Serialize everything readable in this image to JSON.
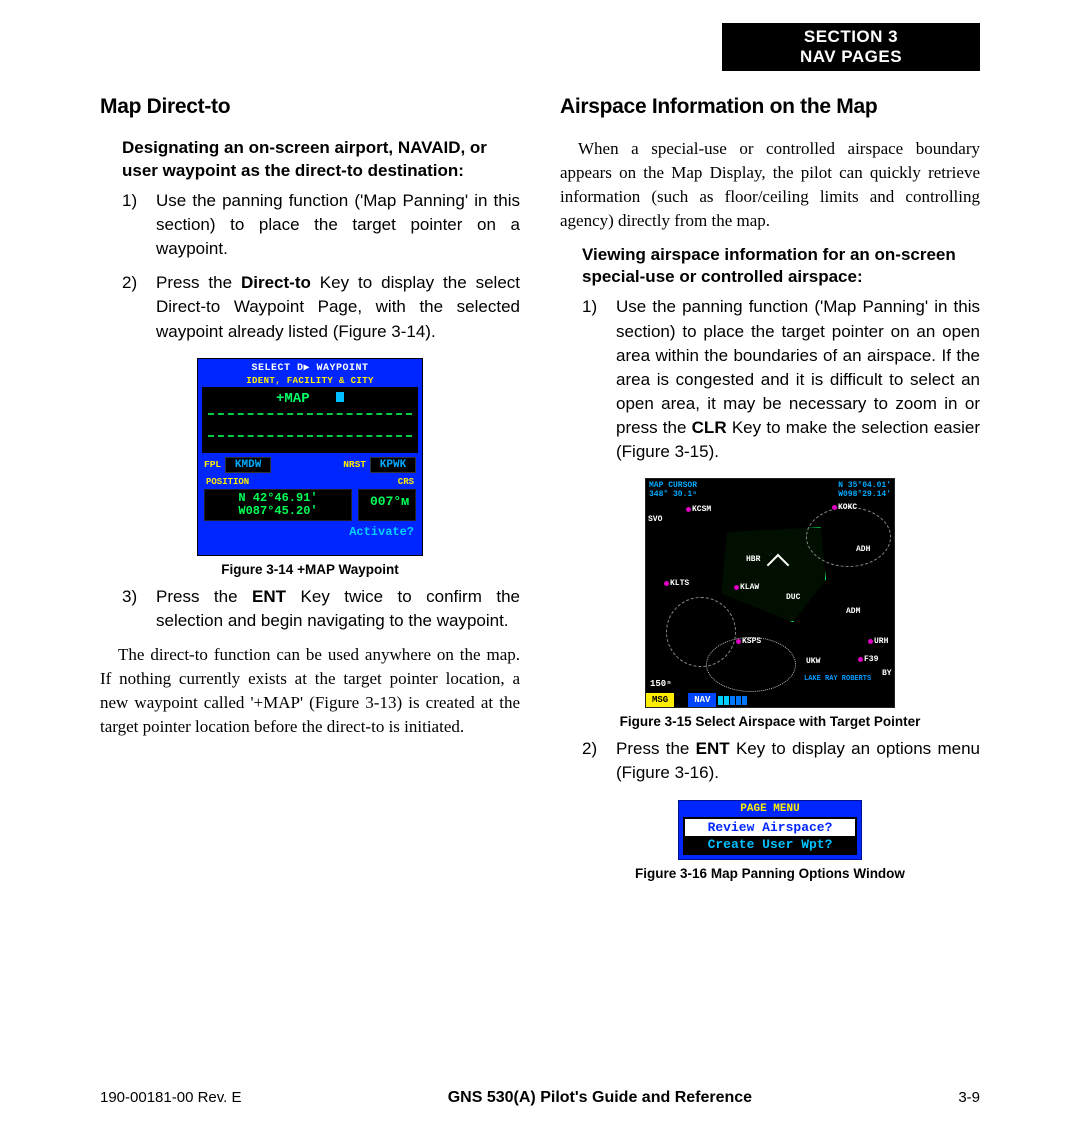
{
  "header": {
    "line1": "SECTION 3",
    "line2": "NAV PAGES"
  },
  "left": {
    "title": "Map Direct-to",
    "subhead": "Designating an on-screen airport, NAVAID, or user waypoint as the direct-to destination:",
    "step1": "Use the panning function ('Map Panning' in this section) to place the target pointer on a waypoint.",
    "step2_a": "Press the ",
    "step2_b": "Direct-to",
    "step2_c": " Key to display the select Direct-to Waypoint Page, with the selected waypoint already listed (Figure 3-14).",
    "step3_a": "Press the ",
    "step3_b": "ENT",
    "step3_c": " Key twice to confirm the selection and begin navigating to the waypoint.",
    "para": "The direct-to function can be used anywhere on the map.  If nothing currently exists at the target pointer location, a new waypoint called '+MAP' (Figure 3-13) is created at the target pointer location before the direct-to is initiated.",
    "fig314": {
      "title_a": "SELECT ",
      "title_b": "D▶",
      "title_c": " WAYPOINT",
      "sub": "IDENT, FACILITY & CITY",
      "map": "+MAP",
      "fpl_label": "FPL",
      "fpl_val": "KMDW",
      "nrst_label": "NRST",
      "nrst_val": "KPWK",
      "pos_label": "POSITION",
      "crs_label": "CRS",
      "pos_n": "N 42°46.91'",
      "pos_w": "W087°45.20'",
      "crs_val": "007°ᴍ",
      "activate": "Activate?",
      "caption": "Figure 3-14  +MAP Waypoint"
    }
  },
  "right": {
    "title": "Airspace Information on the Map",
    "intro": "When a special-use or controlled airspace boundary appears on the Map Display, the pilot can quickly retrieve information (such as floor/ceiling limits and controlling agency) directly from the map.",
    "subhead": "Viewing airspace information for an on-screen special-use or controlled airspace:",
    "step1_a": "Use the panning function ('Map Panning' in this section) to place the target pointer on an open area within the boundaries of an airspace.  If the area is congested and it is difficult to select an open area, it may be necessary to zoom in or press the ",
    "step1_b": "CLR",
    "step1_c": " Key to make the selection easier (Figure 3-15).",
    "step2_a": "Press the ",
    "step2_b": "ENT",
    "step2_c": " Key to display an options menu (Figure 3-16).",
    "fig315": {
      "top_l1": "MAP CURSOR",
      "top_l2": "348° 30.1ⁿ",
      "top_r1": "N 35°04.01'",
      "top_r2": "W098°29.14'",
      "wp": {
        "kcsm": "KCSM",
        "svo": "SVO",
        "kokc": "KOKC",
        "hbr": "HBR",
        "klts": "KLTS",
        "klaw": "KLAW",
        "duc": "DUC",
        "adh": "ADH",
        "adm": "ADM",
        "ksps": "KSPS",
        "ukw": "UKW",
        "urh": "URH",
        "f39": "F39",
        "by": "BY",
        "roberts": "LAKE RAY ROBERTS"
      },
      "scale": "150ⁿ",
      "msg": "MSG",
      "nav": "NAV",
      "caption": "Figure 3-15  Select Airspace with Target Pointer"
    },
    "fig316": {
      "title": "PAGE MENU",
      "row1": "Review Airspace?",
      "row2": "Create User Wpt?",
      "caption": "Figure 3-16  Map Panning Options Window"
    }
  },
  "footer": {
    "left": "190-00181-00  Rev. E",
    "mid": "GNS 530(A) Pilot's Guide and Reference",
    "right": "3-9"
  }
}
